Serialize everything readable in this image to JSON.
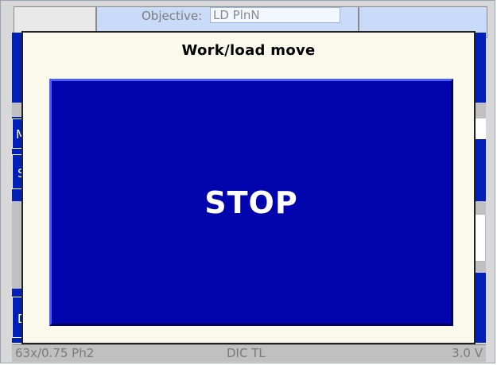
{
  "header": {
    "objective_label": "Objective:",
    "objective_value": "LD PlnN"
  },
  "side_buttons": {
    "left_top_label": "Mi",
    "left_mid_label": "S",
    "left_bottom_label": "D"
  },
  "status_bar": {
    "objective": "63x/0.75 Ph2",
    "contrast": "DIC TL",
    "voltage": "3.0 V"
  },
  "dialog": {
    "title": "Work/load move",
    "stop_label": "STOP"
  },
  "colors": {
    "stop_blue": "#0204ad",
    "panel_blue": "#0020b8",
    "dialog_bg": "#fbf9ec"
  }
}
